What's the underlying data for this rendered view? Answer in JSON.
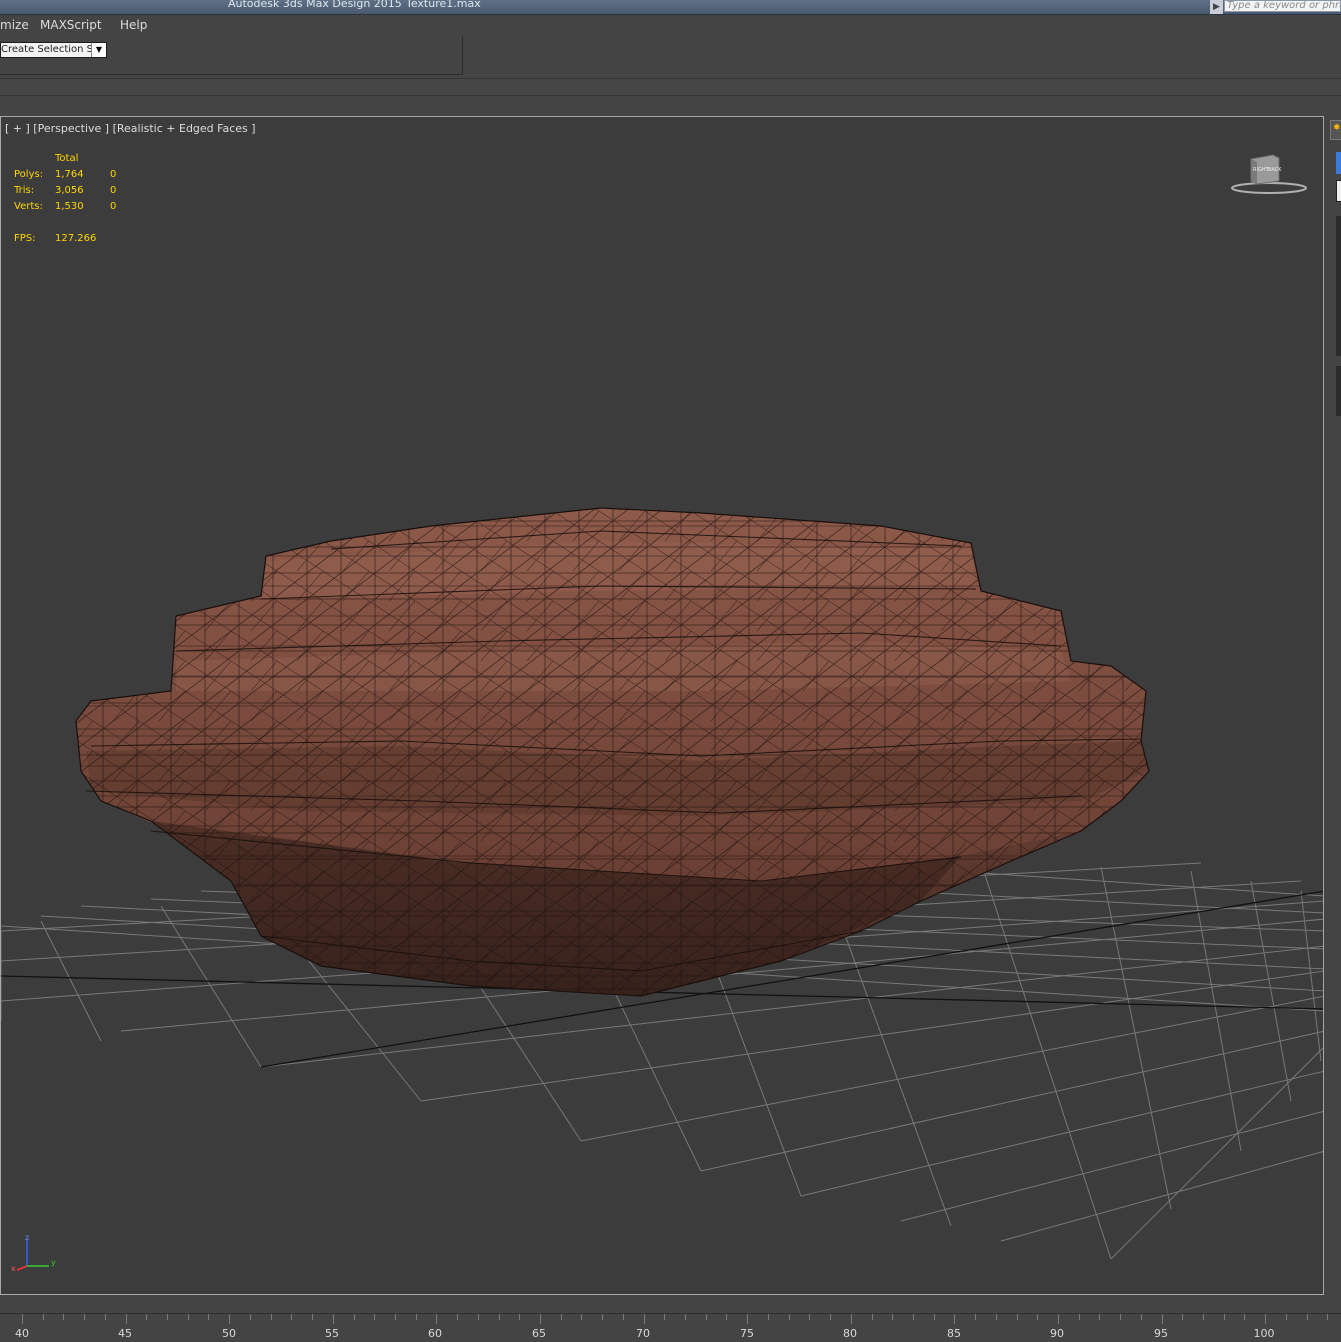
{
  "window": {
    "app_title": "Autodesk 3ds Max Design 2015",
    "file_name": "Texture1.max",
    "search_placeholder": "Type a keyword or phrase"
  },
  "menu": {
    "items": [
      "mize",
      "MAXScript",
      "Help"
    ]
  },
  "toolbar": {
    "selection_set_value": "Create Selection Se"
  },
  "viewport": {
    "label": "[ + ] [Perspective ] [Realistic + Edged Faces ]",
    "stats": {
      "total_header": "Total",
      "rows": [
        {
          "label": "Polys:",
          "total": "1,764",
          "selected": "0"
        },
        {
          "label": "Tris:",
          "total": "3,056",
          "selected": "0"
        },
        {
          "label": "Verts:",
          "total": "1,530",
          "selected": "0"
        }
      ],
      "fps_label": "FPS:",
      "fps_value": "127.266"
    },
    "viewcube_face_label": "RIGHT",
    "viewcube_face_label2": "BACK",
    "axis_labels": {
      "z": "z",
      "x": "x",
      "y": "y"
    },
    "object": "rock mesh, realistic texture with edged faces",
    "colors": {
      "background": "#3c3c3c",
      "grid": "#8a8a8a",
      "stats_text": "#ffd700",
      "rock_base": "#7a4a3c"
    }
  },
  "timeline": {
    "ruler_labels": [
      "40",
      "45",
      "50",
      "55",
      "60",
      "65",
      "70",
      "75",
      "80",
      "85",
      "90",
      "95",
      "100"
    ]
  }
}
